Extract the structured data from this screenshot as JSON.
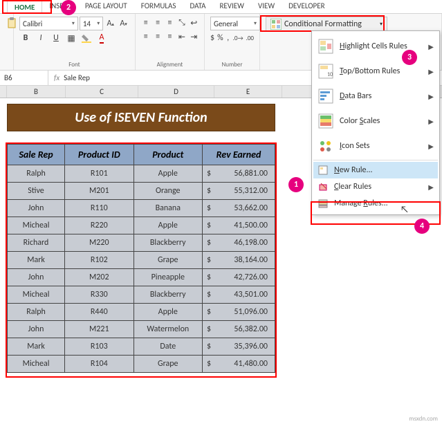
{
  "tabs": [
    "HOME",
    "INSERT",
    "PAGE LAYOUT",
    "FORMULAS",
    "DATA",
    "REVIEW",
    "VIEW",
    "DEVELOPER"
  ],
  "font": {
    "name": "Calibri",
    "size": "14"
  },
  "number_format": "General",
  "cf_label": "Conditional Formatting",
  "group_labels": {
    "font": "Font",
    "alignment": "Alignment",
    "number": "Number"
  },
  "namebox": "B6",
  "fx_value": "Sale Rep",
  "col_headers": [
    "B",
    "C",
    "D",
    "E"
  ],
  "sheet_title": "Use of ISEVEN Function",
  "table_headers": [
    "Sale Rep",
    "Product ID",
    "Product",
    "Rev Earned"
  ],
  "rows": [
    {
      "rep": "Ralph",
      "pid": "R101",
      "prod": "Apple",
      "rev": "56,881.00"
    },
    {
      "rep": "Stive",
      "pid": "M201",
      "prod": "Orange",
      "rev": "55,312.00"
    },
    {
      "rep": "John",
      "pid": "R110",
      "prod": "Banana",
      "rev": "53,662.00"
    },
    {
      "rep": "Micheal",
      "pid": "R220",
      "prod": "Apple",
      "rev": "41,500.00"
    },
    {
      "rep": "Richard",
      "pid": "M220",
      "prod": "Blackberry",
      "rev": "46,198.00"
    },
    {
      "rep": "Mark",
      "pid": "R102",
      "prod": "Grape",
      "rev": "38,164.00"
    },
    {
      "rep": "John",
      "pid": "M202",
      "prod": "Pineapple",
      "rev": "42,726.00"
    },
    {
      "rep": "Micheal",
      "pid": "R330",
      "prod": "Blackberry",
      "rev": "43,501.00"
    },
    {
      "rep": "Ralph",
      "pid": "R440",
      "prod": "Apple",
      "rev": "51,096.00"
    },
    {
      "rep": "John",
      "pid": "M221",
      "prod": "Watermelon",
      "rev": "56,382.00"
    },
    {
      "rep": "Mark",
      "pid": "R103",
      "prod": "Date",
      "rev": "35,396.00"
    },
    {
      "rep": "Micheal",
      "pid": "R104",
      "prod": "Grape",
      "rev": "41,480.00"
    }
  ],
  "cf_menu": {
    "items": [
      {
        "label": "Highlight Cells Rules",
        "icon": "hcr",
        "sub": true
      },
      {
        "label": "Top/Bottom Rules",
        "icon": "tbr",
        "sub": true
      },
      {
        "label": "Data Bars",
        "icon": "db",
        "sub": true
      },
      {
        "label": "Color Scales",
        "icon": "cs",
        "sub": true
      },
      {
        "label": "Icon Sets",
        "icon": "is",
        "sub": true
      }
    ],
    "lower": [
      {
        "label": "New Rule...",
        "icon": "new"
      },
      {
        "label": "Clear Rules",
        "icon": "clear",
        "sub": true
      },
      {
        "label": "Manage Rules...",
        "icon": "manage"
      }
    ]
  },
  "badges": {
    "b1": "1",
    "b2": "2",
    "b3": "3",
    "b4": "4"
  },
  "watermark": "msxdn.com"
}
